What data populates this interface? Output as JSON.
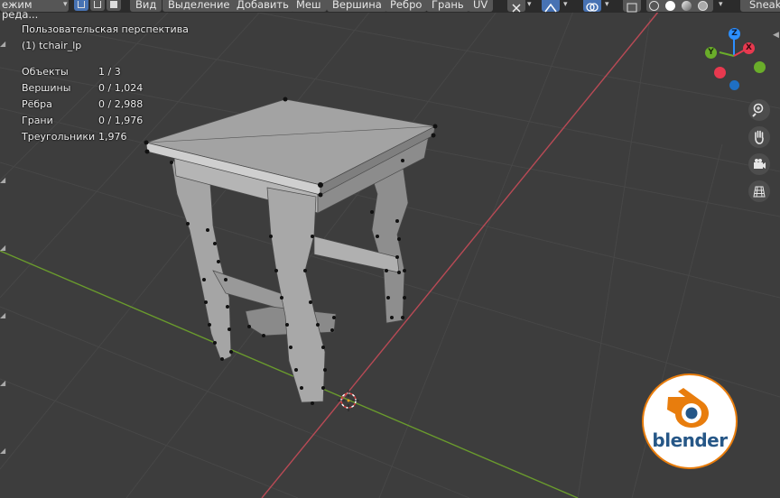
{
  "header": {
    "mode_label": "ежим реда...",
    "menus": [
      "Вид",
      "Выделение",
      "Добавить",
      "Меш",
      "Вершина",
      "Ребро",
      "Грань",
      "UV"
    ],
    "workspace_tab": "Sneak"
  },
  "overlay": {
    "view_name": "Пользовательская перспектива",
    "object_name": "(1) tchair_lp",
    "stats": [
      {
        "label": "Объекты",
        "value": "1 / 3"
      },
      {
        "label": "Вершины",
        "value": "0 / 1,024"
      },
      {
        "label": "Рёбра",
        "value": "0 / 2,988"
      },
      {
        "label": "Грани",
        "value": "0 / 1,976"
      },
      {
        "label": "Треугольники",
        "value": "1,976"
      }
    ]
  },
  "gizmo": {
    "z": "Z",
    "y": "Y",
    "x": "X",
    "colors": {
      "x": "#e8394f",
      "y": "#6aad2a",
      "z": "#2c8fff"
    }
  },
  "nav_icons": [
    "zoom-icon",
    "pan-hand-icon",
    "camera-icon",
    "perspective-grid-icon"
  ],
  "logo": {
    "text": "blender"
  },
  "colors": {
    "background": "#3d3d3d",
    "x_axis": "#b84a55",
    "y_axis": "#6a9b2d",
    "mesh": "#9c9c9c",
    "selection_header": "#4772b3"
  }
}
